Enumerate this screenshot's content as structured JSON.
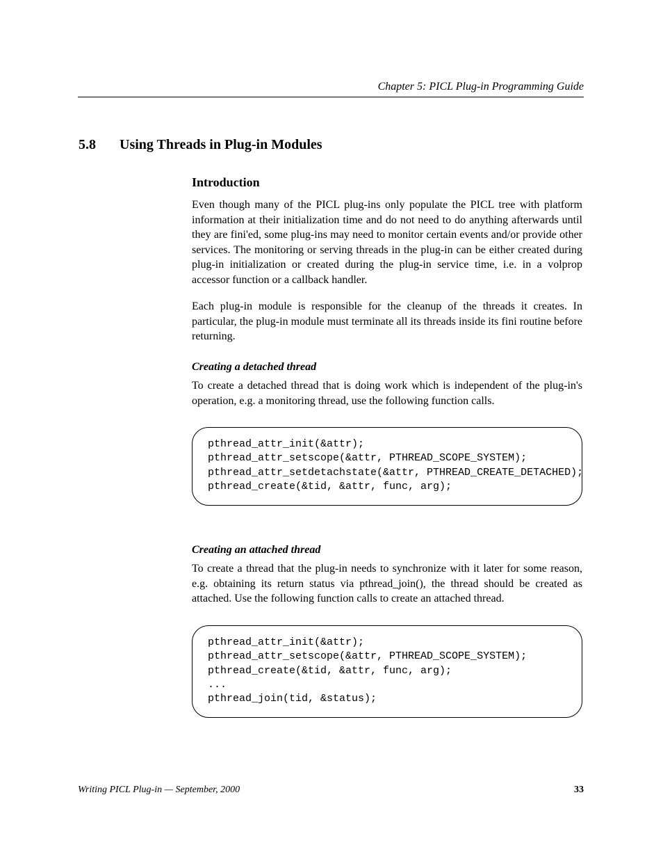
{
  "header": {
    "left": "",
    "right": "Chapter 5: PICL Plug-in Programming Guide"
  },
  "section": {
    "number": "5.8",
    "title": "Using Threads in Plug-in Modules"
  },
  "intro": {
    "heading": "Introduction",
    "p1": "Even though many of the PICL plug-ins only populate the PICL tree with platform information at their initialization time and do not need to do anything afterwards until they are fini'ed, some plug-ins may need to monitor certain events and/or provide other services. The monitoring or serving threads in the plug-in can be either created during plug-in initialization or created during the plug-in service time, i.e. in a volprop accessor function or a callback handler.",
    "p2": "Each plug-in module is responsible for the cleanup of the threads it creates. In particular, the plug-in module must terminate all its threads inside its fini routine before returning."
  },
  "block1": {
    "heading": "Creating a detached thread",
    "p1": "To create a detached thread that is doing work which is independent of the plug-in's operation, e.g. a monitoring thread, use the following function calls.",
    "code": "pthread_attr_init(&attr);\npthread_attr_setscope(&attr, PTHREAD_SCOPE_SYSTEM);\npthread_attr_setdetachstate(&attr, PTHREAD_CREATE_DETACHED);\npthread_create(&tid, &attr, func, arg);"
  },
  "block2": {
    "heading": "Creating an attached thread",
    "p1": "To create a thread that the plug-in needs to synchronize with it later for some reason, e.g. obtaining its return status via pthread_join(), the thread should be created as attached. Use the following function calls to create an attached thread.",
    "code": "pthread_attr_init(&attr);\npthread_attr_setscope(&attr, PTHREAD_SCOPE_SYSTEM);\npthread_create(&tid, &attr, func, arg);\n...\npthread_join(tid, &status);"
  },
  "footer": {
    "text": "Writing PICL Plug-in    —    September, 2000",
    "page": "33"
  }
}
